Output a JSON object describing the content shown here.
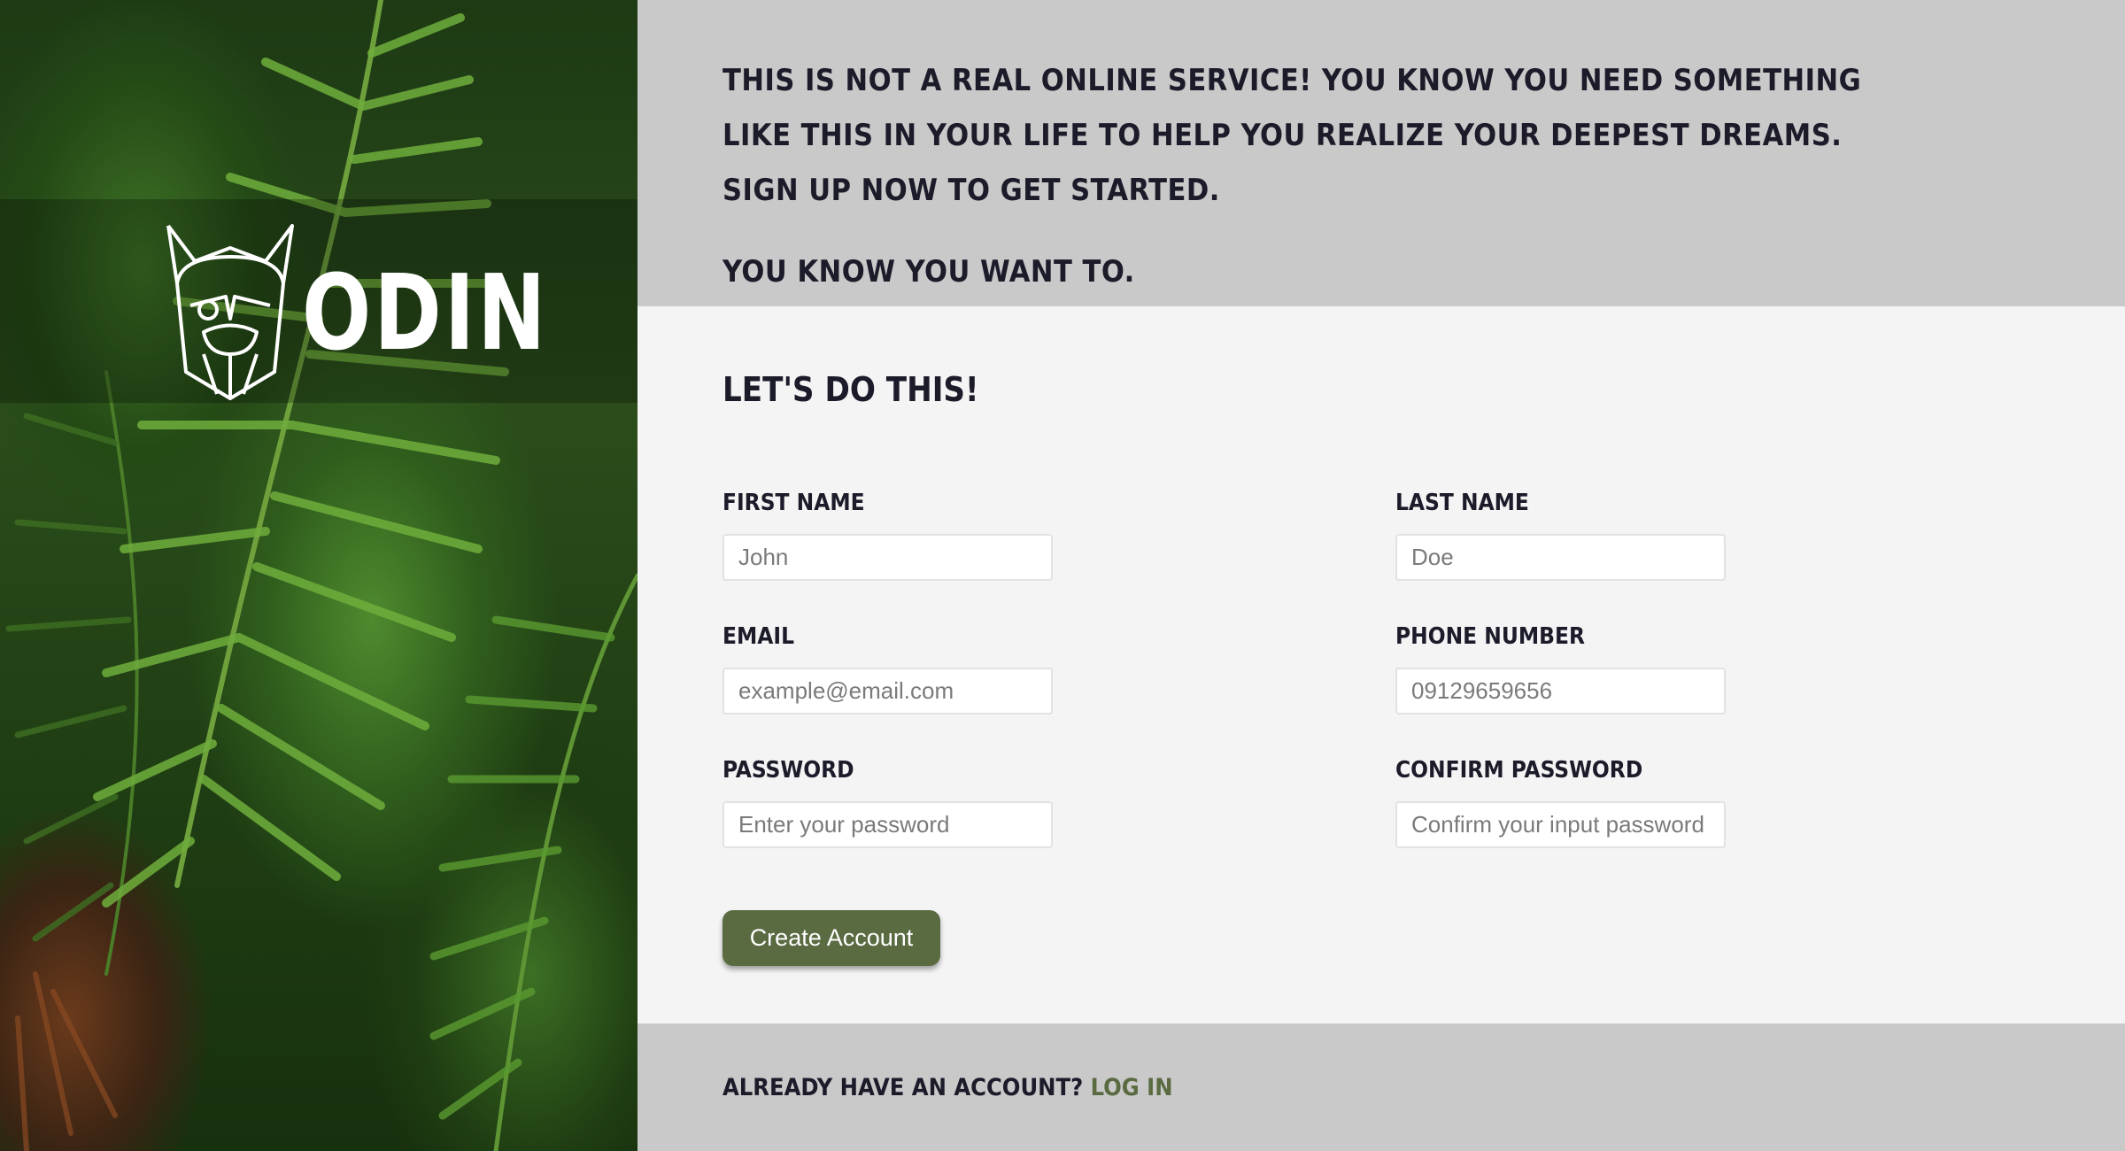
{
  "brand": {
    "name": "ODIN"
  },
  "intro": {
    "paragraph1": "This is not a real online service! You know you need something like this in your life to help you realize your deepest dreams. Sign up now to get started.",
    "paragraph2": "You know you want to."
  },
  "form": {
    "title": "Let's do this!",
    "fields": {
      "first_name": {
        "label": "First Name",
        "placeholder": "John"
      },
      "last_name": {
        "label": "Last Name",
        "placeholder": "Doe"
      },
      "email": {
        "label": "Email",
        "placeholder": "example@email.com"
      },
      "phone": {
        "label": "Phone Number",
        "placeholder": "09129659656"
      },
      "password": {
        "label": "Password",
        "placeholder": "Enter your password"
      },
      "confirm_password": {
        "label": "Confirm Password",
        "placeholder": "Confirm your input password"
      }
    },
    "submit_label": "Create Account"
  },
  "footer": {
    "prompt": "Already have an account?",
    "login_label": "Log in"
  },
  "colors": {
    "accent": "#5a6b42",
    "intro_bg": "#c9c9c9",
    "form_bg": "#f4f4f4",
    "text_dark": "#1b1b2a"
  },
  "icons": {
    "logo": "viking-helmet-icon"
  }
}
